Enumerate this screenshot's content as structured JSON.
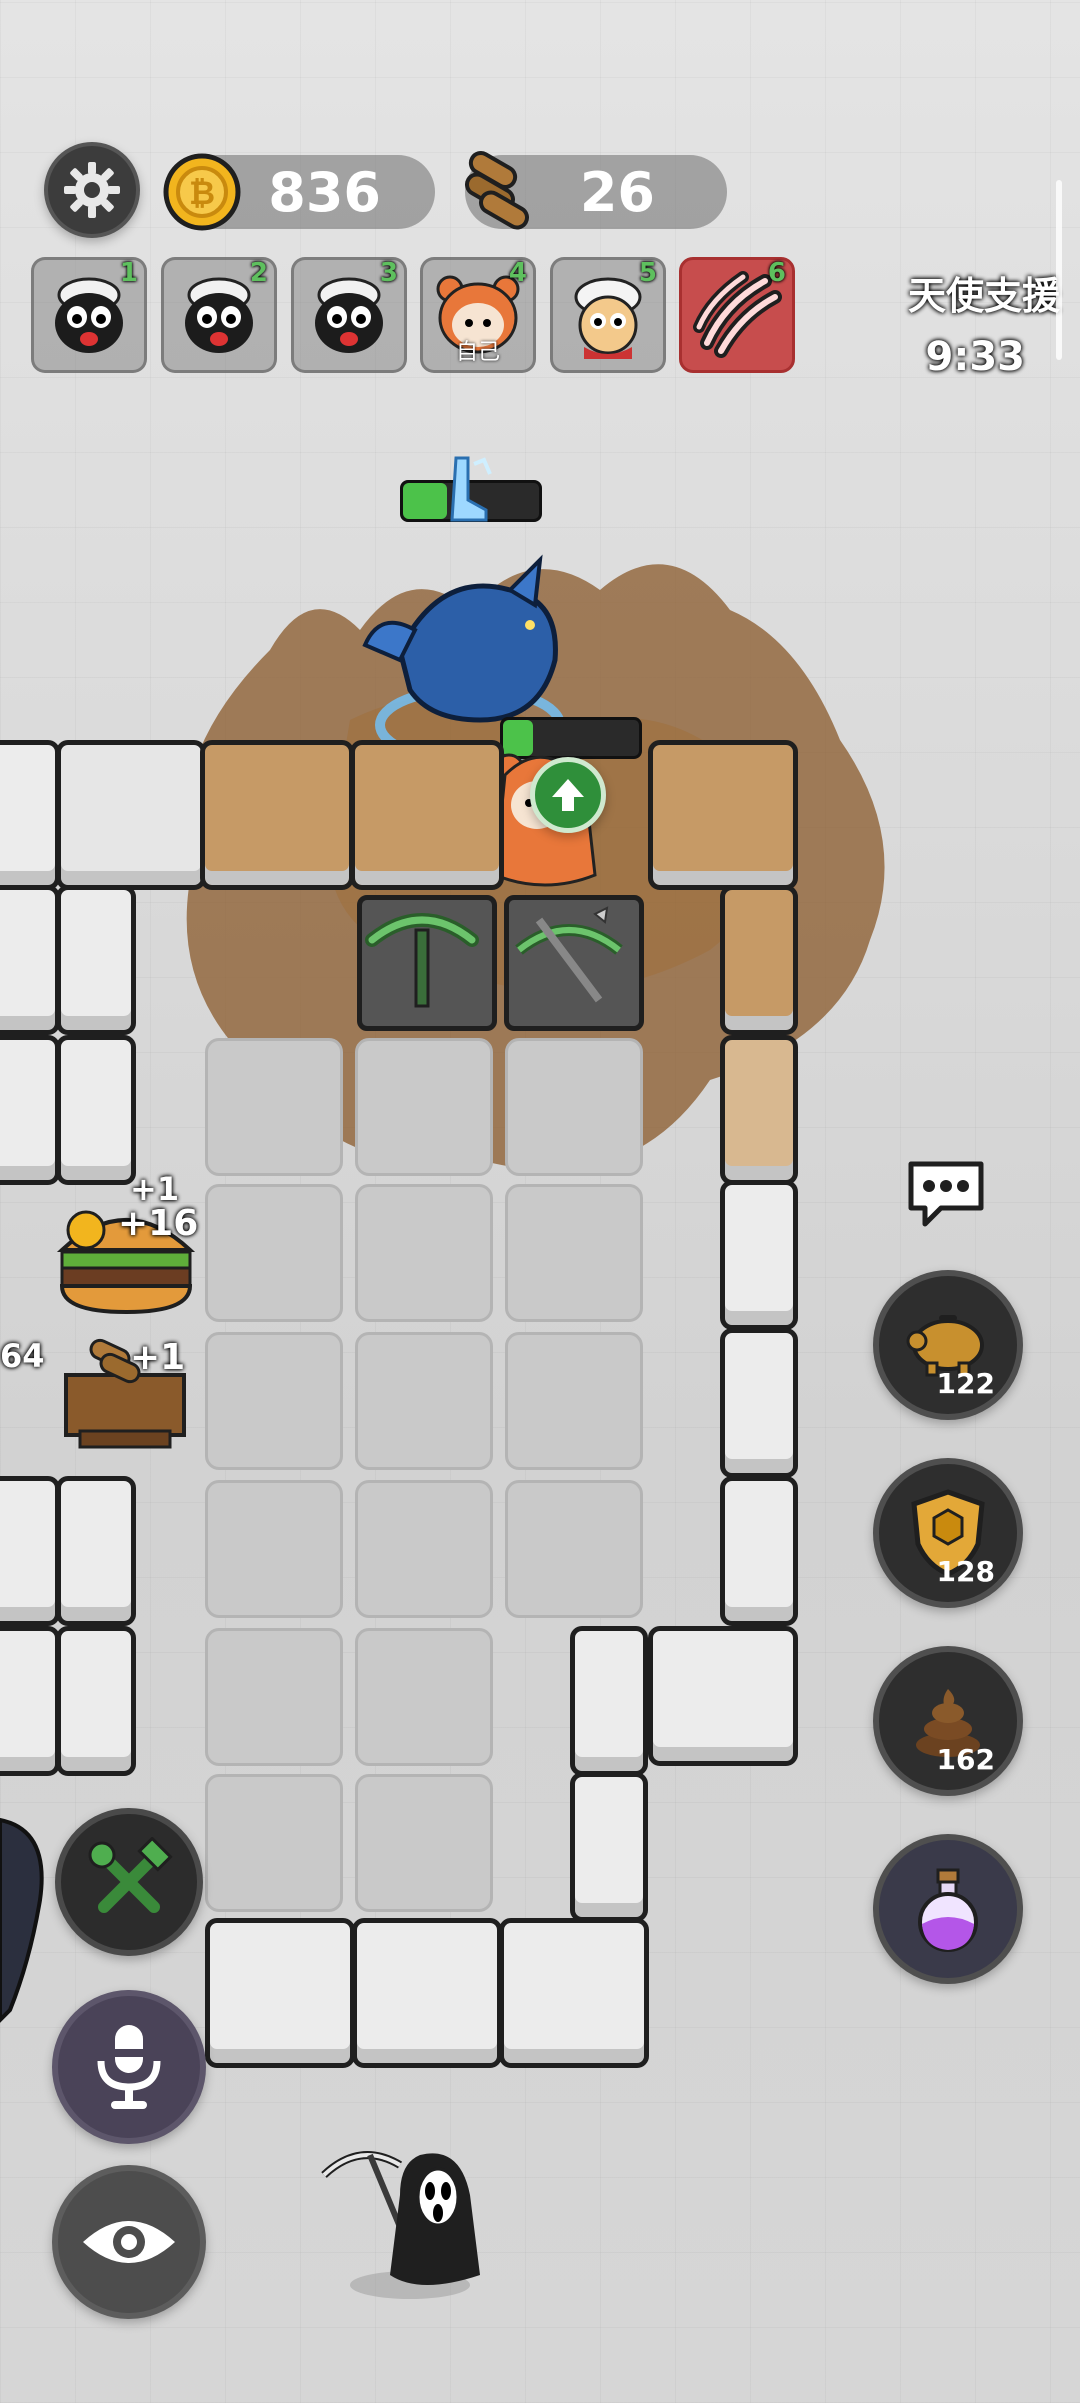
{
  "hud": {
    "coins": "836",
    "wood": "26",
    "event_title": "天使支援",
    "event_timer": "9:33"
  },
  "players": [
    {
      "num": "1",
      "tag": ""
    },
    {
      "num": "2",
      "tag": ""
    },
    {
      "num": "3",
      "tag": ""
    },
    {
      "num": "4",
      "tag": "自己"
    },
    {
      "num": "5",
      "tag": ""
    },
    {
      "num": "6",
      "tag": ""
    }
  ],
  "board": {
    "burger_wood_gain": "+1",
    "burger_coin_gain": "+16",
    "sawmill_wood_gain": "+1",
    "edge_count": "64"
  },
  "side_buttons": {
    "piggy_count": "122",
    "shield_count": "128",
    "poop_count": "162"
  },
  "colors": {
    "coin": "#f2b51e",
    "active_player": "#c74d4d",
    "hp_green": "#4cc24a",
    "mud": "#8a5a2b"
  }
}
